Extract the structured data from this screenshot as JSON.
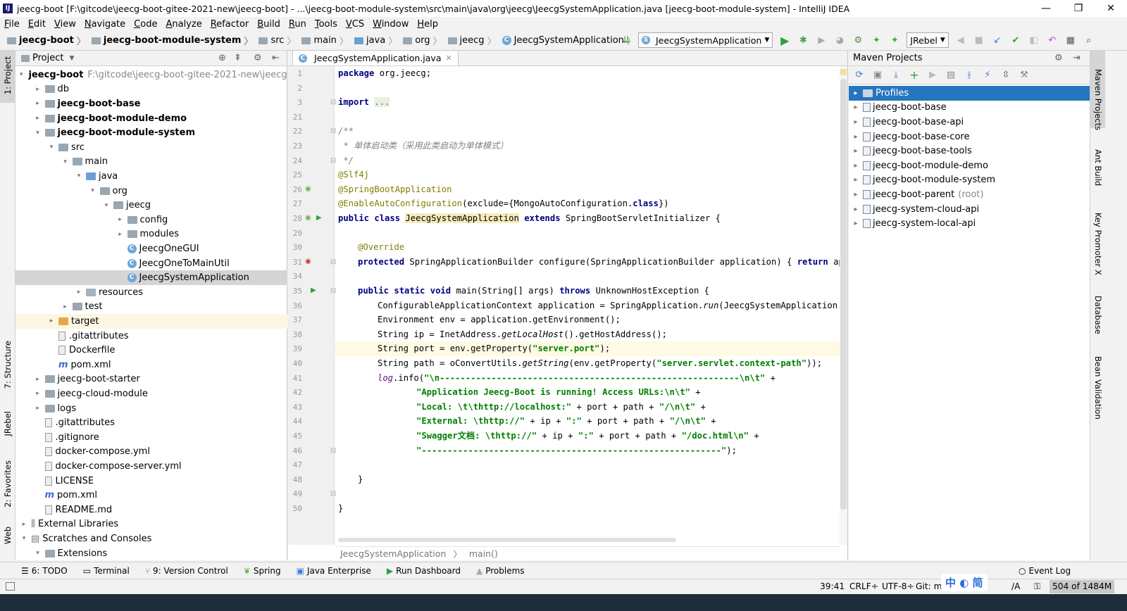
{
  "window": {
    "title": "jeecg-boot [F:\\gitcode\\jeecg-boot-gitee-2021-new\\jeecg-boot] - ...\\jeecg-boot-module-system\\src\\main\\java\\org\\jeecg\\JeecgSystemApplication.java [jeecg-boot-module-system] - IntelliJ IDEA",
    "minimize": "—",
    "maximize": "❐",
    "close": "✕"
  },
  "menu": [
    "File",
    "Edit",
    "View",
    "Navigate",
    "Code",
    "Analyze",
    "Refactor",
    "Build",
    "Run",
    "Tools",
    "VCS",
    "Window",
    "Help"
  ],
  "breadcrumbs": [
    "jeecg-boot",
    "jeecg-boot-module-system",
    "src",
    "main",
    "java",
    "org",
    "jeecg",
    "JeecgSystemApplication"
  ],
  "toolbar": {
    "run_config": "JeecgSystemApplication",
    "jrebel": "JRebel"
  },
  "left_strip": {
    "project": "1: Project",
    "structure": "7: Structure",
    "jrebel": "JRebel",
    "favorites": "2: Favorites",
    "web": "Web"
  },
  "project_panel": {
    "title": "Project",
    "tree": [
      {
        "label": "jeecg-boot",
        "extra": "F:\\gitcode\\jeecg-boot-gitee-2021-new\\jeecg-boot",
        "indent": 0,
        "arrow": "▼",
        "icon": "folder",
        "bold": true
      },
      {
        "label": "db",
        "indent": 1,
        "arrow": "▶",
        "icon": "folder"
      },
      {
        "label": "jeecg-boot-base",
        "indent": 1,
        "arrow": "▶",
        "icon": "module",
        "bold": true
      },
      {
        "label": "jeecg-boot-module-demo",
        "indent": 1,
        "arrow": "▶",
        "icon": "module",
        "bold": true
      },
      {
        "label": "jeecg-boot-module-system",
        "indent": 1,
        "arrow": "▼",
        "icon": "module",
        "bold": true
      },
      {
        "label": "src",
        "indent": 2,
        "arrow": "▼",
        "icon": "folder"
      },
      {
        "label": "main",
        "indent": 3,
        "arrow": "▼",
        "icon": "folder"
      },
      {
        "label": "java",
        "indent": 4,
        "arrow": "▼",
        "icon": "src"
      },
      {
        "label": "org",
        "indent": 5,
        "arrow": "▼",
        "icon": "folder"
      },
      {
        "label": "jeecg",
        "indent": 6,
        "arrow": "▼",
        "icon": "folder"
      },
      {
        "label": "config",
        "indent": 7,
        "arrow": "▶",
        "icon": "folder"
      },
      {
        "label": "modules",
        "indent": 7,
        "arrow": "▶",
        "icon": "folder"
      },
      {
        "label": "JeecgOneGUI",
        "indent": 7,
        "arrow": "",
        "icon": "class"
      },
      {
        "label": "JeecgOneToMainUtil",
        "indent": 7,
        "arrow": "",
        "icon": "class"
      },
      {
        "label": "JeecgSystemApplication",
        "indent": 7,
        "arrow": "",
        "icon": "class",
        "selected": true
      },
      {
        "label": "resources",
        "indent": 4,
        "arrow": "▶",
        "icon": "res"
      },
      {
        "label": "test",
        "indent": 3,
        "arrow": "▶",
        "icon": "folder"
      },
      {
        "label": "target",
        "indent": 2,
        "arrow": "▶",
        "icon": "orange",
        "target": true
      },
      {
        "label": ".gitattributes",
        "indent": 2,
        "arrow": "",
        "icon": "doc"
      },
      {
        "label": "Dockerfile",
        "indent": 2,
        "arrow": "",
        "icon": "doc"
      },
      {
        "label": "pom.xml",
        "indent": 2,
        "arrow": "",
        "icon": "maven"
      },
      {
        "label": "jeecg-boot-starter",
        "indent": 1,
        "arrow": "▶",
        "icon": "folder"
      },
      {
        "label": "jeecg-cloud-module",
        "indent": 1,
        "arrow": "▶",
        "icon": "folder"
      },
      {
        "label": "logs",
        "indent": 1,
        "arrow": "▶",
        "icon": "folder"
      },
      {
        "label": ".gitattributes",
        "indent": 1,
        "arrow": "",
        "icon": "doc"
      },
      {
        "label": ".gitignore",
        "indent": 1,
        "arrow": "",
        "icon": "doc"
      },
      {
        "label": "docker-compose.yml",
        "indent": 1,
        "arrow": "",
        "icon": "doc"
      },
      {
        "label": "docker-compose-server.yml",
        "indent": 1,
        "arrow": "",
        "icon": "doc"
      },
      {
        "label": "LICENSE",
        "indent": 1,
        "arrow": "",
        "icon": "doc"
      },
      {
        "label": "pom.xml",
        "indent": 1,
        "arrow": "",
        "icon": "maven"
      },
      {
        "label": "README.md",
        "indent": 1,
        "arrow": "",
        "icon": "doc"
      },
      {
        "label": "External Libraries",
        "indent": 0,
        "arrow": "▶",
        "icon": "lib"
      },
      {
        "label": "Scratches and Consoles",
        "indent": 0,
        "arrow": "▼",
        "icon": "scratch"
      },
      {
        "label": "Extensions",
        "indent": 1,
        "arrow": "▼",
        "icon": "folder"
      }
    ]
  },
  "editor": {
    "tab": "JeecgSystemApplication.java",
    "line_numbers": [
      "1",
      "2",
      "3",
      "21",
      "22",
      "23",
      "24",
      "25",
      "26",
      "27",
      "28",
      "29",
      "30",
      "31",
      "34",
      "35",
      "36",
      "37",
      "38",
      "39",
      "40",
      "41",
      "42",
      "43",
      "44",
      "45",
      "46",
      "47",
      "48",
      "49",
      "50"
    ],
    "breadcrumb": [
      "JeecgSystemApplication",
      "main()"
    ],
    "code": {
      "l1": "org.jeecg;",
      "l3": "...",
      "l22": "/**",
      "l23": " * 单体启动类（采用此类启动为单体模式）",
      "l24": " */",
      "l25": "@Slf4j",
      "l26": "@SpringBootApplication",
      "l27a": "@EnableAutoConfiguration",
      "l27b": "(exclude={MongoAutoConfiguration.",
      "l27c": "})",
      "l28a": "JeecgSystemApplication",
      "l28b": " SpringBootServletInitializer {",
      "l30": "@Override",
      "l31a": " SpringApplicationBuilder configure(SpringApplicationBuilder application) { ",
      "l31b": " applicatio",
      "l35a": " main(String[] args) ",
      "l35b": " UnknownHostException {",
      "l36a": "ConfigurableApplicationContext application = SpringApplication.",
      "l36b": "run",
      "l36c": "(JeecgSystemApplication.",
      "l36d": ", a",
      "l37": "Environment env = application.getEnvironment();",
      "l38a": "String ip = InetAddress.",
      "l38b": "getLocalHost",
      "l38c": "().getHostAddress();",
      "l39a": "String port = env.getProperty(",
      "l39b": "\"server.port\"",
      "l39c": ");",
      "l40a": "String path = oConvertUtils.",
      "l40b": "getString",
      "l40c": "(env.getProperty(",
      "l40d": "\"server.servlet.context-path\"",
      "l40e": "));",
      "l41a": "log",
      "l41b": ".info(",
      "l41c": "\"\\n----------------------------------------------------------\\n\\t\"",
      "l41d": " +",
      "l42a": "\"Application Jeecg-Boot is running! Access URLs:\\n\\t\"",
      "l42b": " +",
      "l43a": "\"Local: \\t\\thttp://localhost:\"",
      "l43b": " + port + path + ",
      "l43c": "\"/\\n\\t\"",
      "l43d": " +",
      "l44a": "\"External: \\thttp://\"",
      "l44b": " + ip + ",
      "l44c": "\":\"",
      "l44d": " + port + path + ",
      "l44e": "\"/\\n\\t\"",
      "l44f": " +",
      "l45a": "\"Swagger文档: \\thttp://\"",
      "l45b": " + ip + ",
      "l45c": "\":\"",
      "l45d": " + port + path + ",
      "l45e": "\"/doc.html\\n\"",
      "l45f": " +",
      "l46a": "\"----------------------------------------------------------\"",
      "l46b": ");",
      "l48": "}",
      "l50": "}"
    },
    "keywords": {
      "package": "package",
      "import": "import",
      "public": "public",
      "class": "class",
      "extends": "extends",
      "protected": "protected",
      "return": "return",
      "static": "static",
      "void": "void",
      "throws": "throws",
      "dotclass": "class"
    }
  },
  "maven": {
    "title": "Maven Projects",
    "items": [
      {
        "label": "Profiles",
        "selected": true,
        "icon": "folder"
      },
      {
        "label": "jeecg-boot-base"
      },
      {
        "label": "jeecg-boot-base-api"
      },
      {
        "label": "jeecg-boot-base-core"
      },
      {
        "label": "jeecg-boot-base-tools"
      },
      {
        "label": "jeecg-boot-module-demo"
      },
      {
        "label": "jeecg-boot-module-system"
      },
      {
        "label": "jeecg-boot-parent",
        "suffix": "(root)"
      },
      {
        "label": "jeecg-system-cloud-api"
      },
      {
        "label": "jeecg-system-local-api"
      }
    ]
  },
  "right_strip": {
    "maven": "Maven Projects",
    "ant": "Ant Build",
    "key": "Key Promoter X",
    "database": "Database",
    "bean": "Bean Validation"
  },
  "bottom_tools": {
    "todo": "6: TODO",
    "terminal": "Terminal",
    "vcs": "9: Version Control",
    "spring": "Spring",
    "java_ent": "Java Enterprise",
    "run_dash": "Run Dashboard",
    "problems": "Problems",
    "event_log": "Event Log"
  },
  "status": {
    "position": "39:41",
    "line_sep": "CRLF÷",
    "encoding": "UTF-8÷",
    "git": "Git: m",
    "na": "/A",
    "memory": "504 of 1484M",
    "ime": "中 ◐ 简"
  },
  "colors": {
    "selection": "#2675bf",
    "keyword": "#000080",
    "string": "#008000",
    "annotation": "#808000",
    "comment": "#808080",
    "current_line": "#fffae3"
  }
}
